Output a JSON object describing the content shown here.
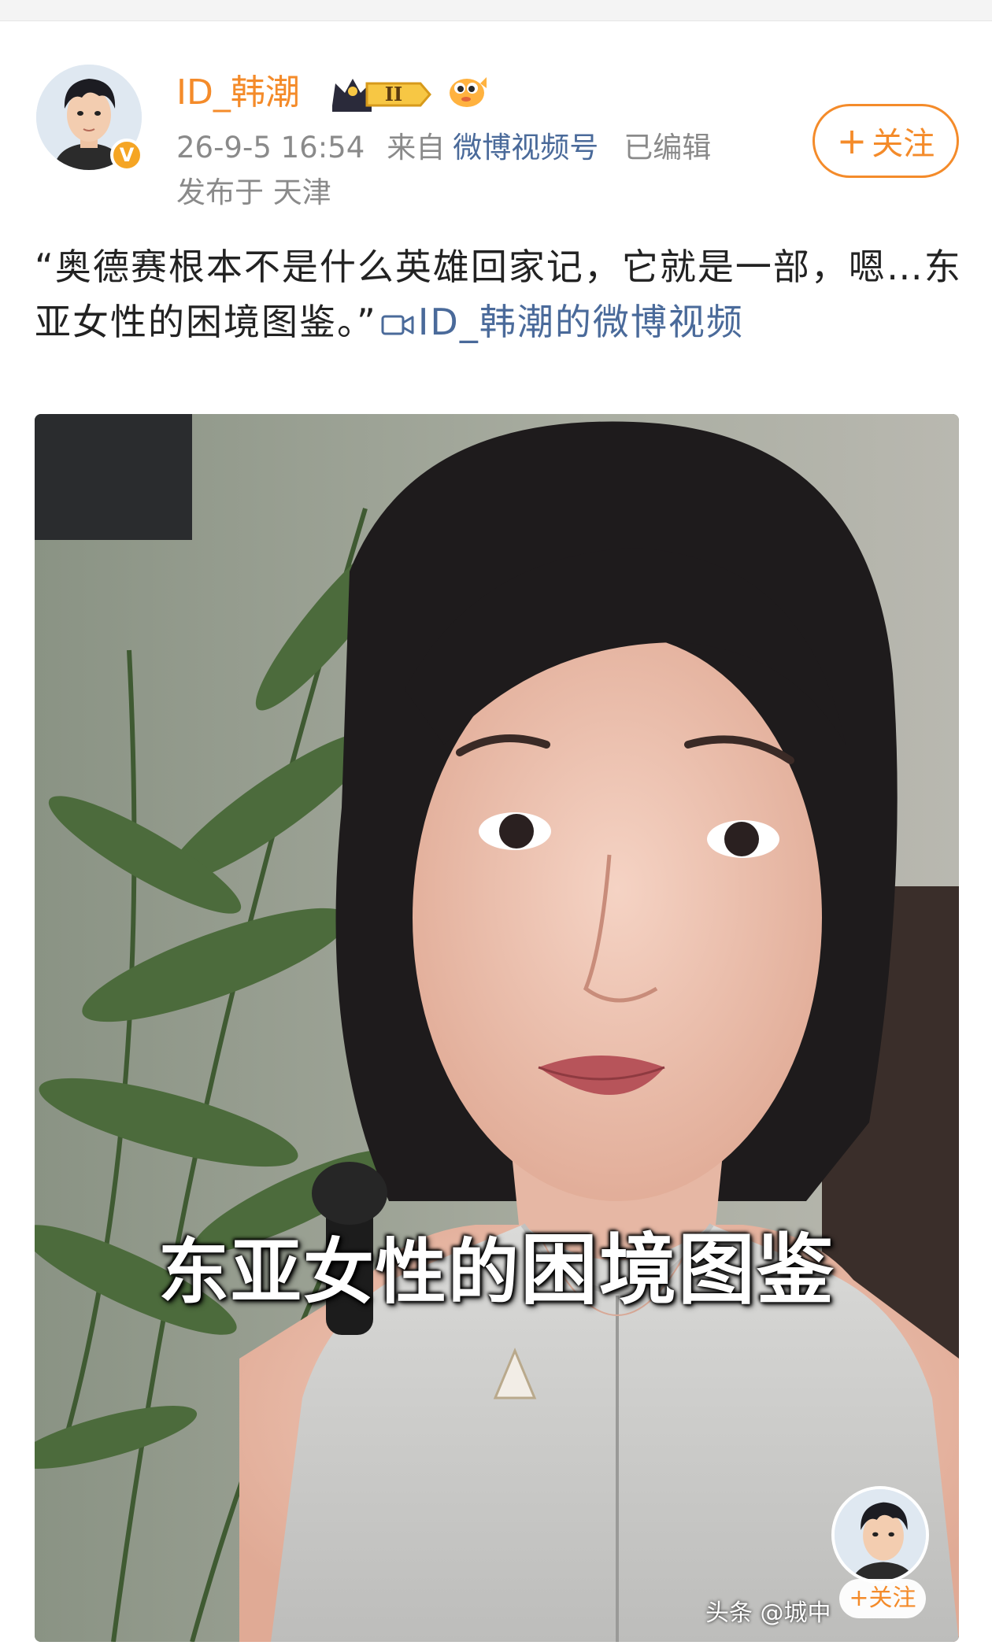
{
  "user": {
    "name": "ID_韩潮",
    "date": "26-9-5 16:54",
    "source_prefix": "来自",
    "source": "微博视频号",
    "edited": "已编辑",
    "location": "发布于 天津",
    "level_badge": "II",
    "verified_badge": "V"
  },
  "follow": {
    "plus": "+",
    "label": "关注"
  },
  "post": {
    "text": "“奥德赛根本不是什么英雄回家记，它就是一部，嗯…东亚女性的困境图鉴。”",
    "link_icon": "video-camera-icon",
    "link_text": "ID_韩潮的微博视频"
  },
  "video": {
    "caption_part1": "东亚女性的",
    "caption_part2": "困境图鉴",
    "mini_follow": "+关注",
    "watermark": "头条 @城中"
  },
  "colors": {
    "accent": "#f48b2a",
    "link": "#4a6a9a",
    "meta": "#8a8a8a"
  }
}
